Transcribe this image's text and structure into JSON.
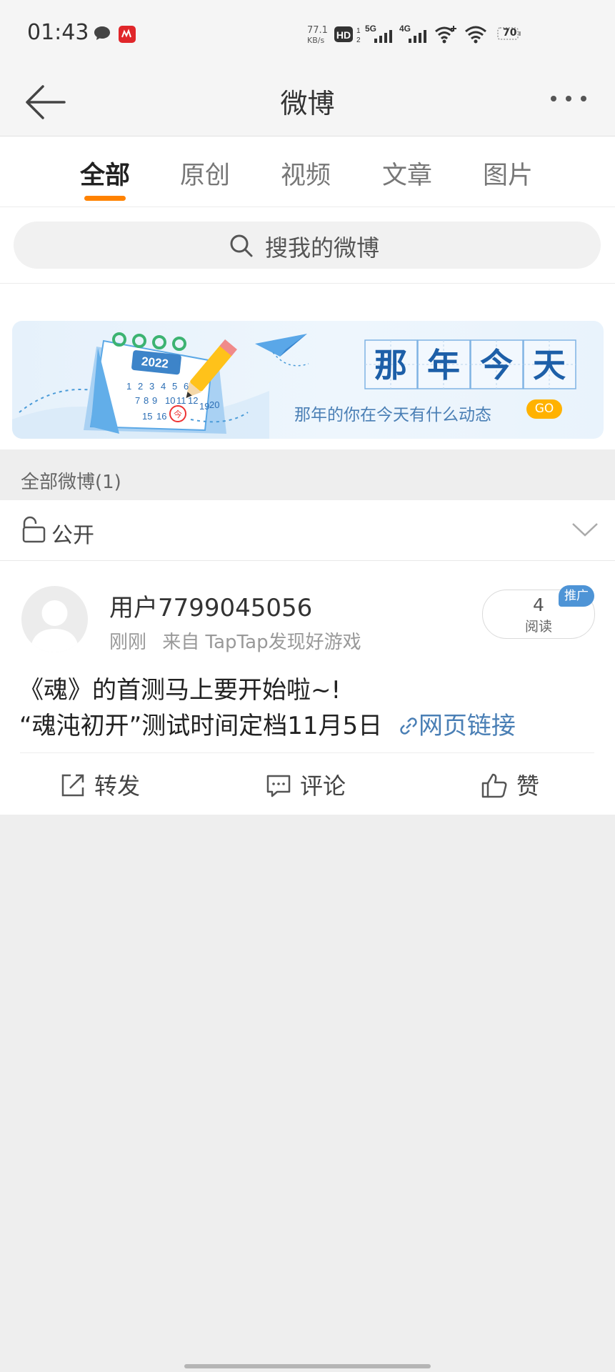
{
  "status_bar": {
    "time": "01:43",
    "net_speed_value": "77.1",
    "net_speed_unit": "KB/s",
    "hd_label": "HD",
    "sig1_label": "5G",
    "sig2_label": "4G",
    "battery": "70"
  },
  "header": {
    "title": "微博",
    "back_icon": "back-arrow-icon",
    "more_icon": "more-dots-icon"
  },
  "tabs": [
    {
      "label": "全部",
      "active": true
    },
    {
      "label": "原创",
      "active": false
    },
    {
      "label": "视频",
      "active": false
    },
    {
      "label": "文章",
      "active": false
    },
    {
      "label": "图片",
      "active": false
    }
  ],
  "search": {
    "placeholder": "搜我的微博",
    "icon": "search-icon"
  },
  "banner": {
    "calendar_year": "2022",
    "calendar_numbers": [
      "1",
      "2",
      "3",
      "4",
      "5",
      "6",
      "7",
      "8",
      "9",
      "10",
      "11",
      "12",
      "15",
      "16",
      "19",
      "20"
    ],
    "calendar_today": "今",
    "title_chars": [
      "那",
      "年",
      "今",
      "天"
    ],
    "subtitle": "那年的你在今天有什么动态",
    "go_label": "GO"
  },
  "section": {
    "label": "全部微博(1)"
  },
  "privacy": {
    "label": "公开",
    "icon": "unlock-icon"
  },
  "post": {
    "username": "用户7799045056",
    "time": "刚刚",
    "source": "来自 TapTap发现好游戏",
    "read_count": "4",
    "read_label": "阅读",
    "promo_label": "推广",
    "line1": "《魂》的首测马上要开始啦~!",
    "line2": "“魂沌初开”测试时间定档11月5日",
    "link_label": "网页链接",
    "actions": {
      "repost": "转发",
      "comment": "评论",
      "like": "赞"
    }
  },
  "colors": {
    "accent": "#ff8200",
    "link": "#4a7fb5",
    "promo": "#4e94d6",
    "go": "#ffb200"
  }
}
